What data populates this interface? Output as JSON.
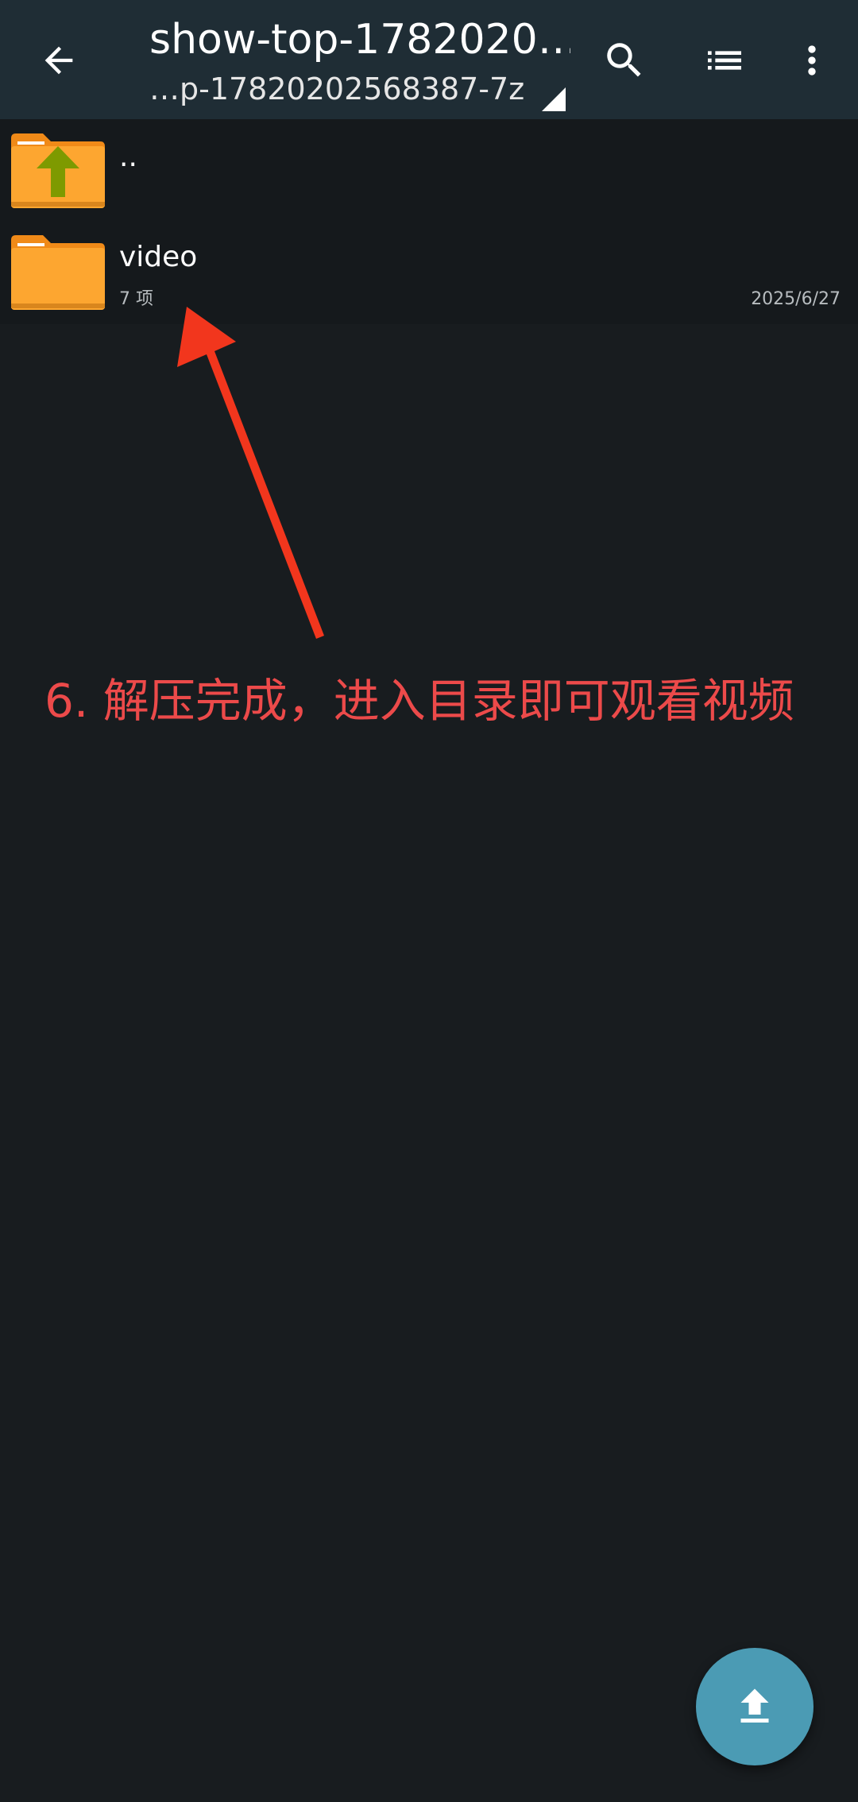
{
  "appbar": {
    "title": "show-top-1782020…",
    "subtitle": "…p-17820202568387-7z"
  },
  "icons": {
    "back": "back-arrow-icon",
    "search": "search-icon",
    "list": "list-view-icon",
    "more": "more-vert-icon",
    "folder_up": "folder-up-icon",
    "folder": "folder-icon",
    "upload": "upload-icon"
  },
  "files": [
    {
      "name": "..",
      "meta": "",
      "date": ""
    },
    {
      "name": "video",
      "meta": "7 项",
      "date": "2025/6/27"
    }
  ],
  "annotation": {
    "text": "6. 解压完成，进入目录即可观看视频",
    "color": "#ec4a4a"
  },
  "colors": {
    "appbar": "#1f2d35",
    "background": "#181c1f",
    "folder": "#fda630",
    "folder_dark": "#f08a18",
    "up_arrow": "#7e9a00",
    "fab": "#4b9bb4"
  }
}
